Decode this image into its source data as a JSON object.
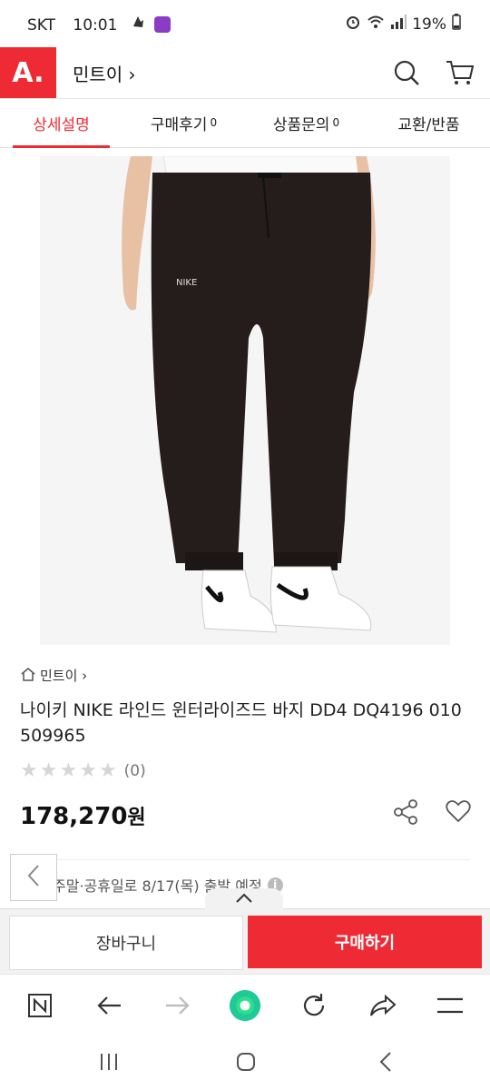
{
  "status_bar": {
    "carrier": "SKT",
    "time": "10:01",
    "battery": "19%"
  },
  "header": {
    "logo": "A.",
    "shop_name": "민트이 ›"
  },
  "tabs": [
    {
      "label": "상세설명",
      "count": ""
    },
    {
      "label": "구매후기",
      "count": "0"
    },
    {
      "label": "상품문의",
      "count": "0"
    },
    {
      "label": "교환/반품",
      "count": ""
    }
  ],
  "product": {
    "image_logo": "NIKE",
    "breadcrumb": "민트이 ›",
    "title": "나이키 NIKE 라인드 윈터라이즈드 바지 DD4 DQ4196 010 509965",
    "rating_count": "(0)",
    "price": "178,270",
    "price_unit": "원",
    "shipping_note": "주말·공휴일로 8/17(목) 출발 예정"
  },
  "actions": {
    "cart": "장바구니",
    "buy": "구매하기"
  },
  "colors": {
    "accent": "#ee2b34"
  },
  "icons": [
    "search-icon",
    "cart-icon",
    "share-icon",
    "heart-icon",
    "home-icon",
    "chevron-left-icon",
    "chevron-up-icon",
    "info-icon",
    "naver-icon",
    "back-arrow-icon",
    "forward-arrow-icon",
    "green-dot-icon",
    "refresh-icon",
    "share-arrow-icon",
    "menu-icon",
    "recent-apps-icon",
    "home-button-icon",
    "back-button-icon"
  ]
}
